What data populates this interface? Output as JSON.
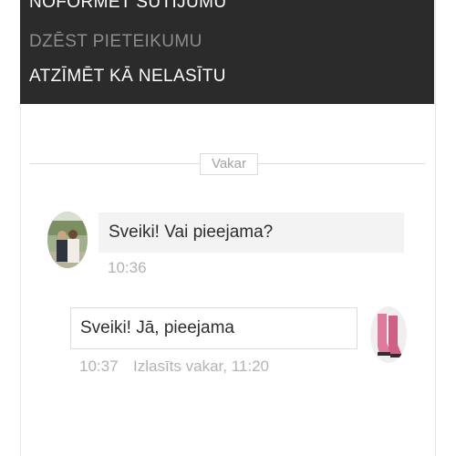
{
  "menu": {
    "items": [
      {
        "label": "NOFORMĒT SŪTĪJUMU"
      },
      {
        "label": "DZĒST PIETEIKUMU"
      },
      {
        "label": "ATZĪMĒT KĀ NELASĪTU"
      }
    ]
  },
  "chat": {
    "date_divider": "Vakar",
    "messages": [
      {
        "text": "Sveiki! Vai pieejama?",
        "time": "10:36",
        "direction": "incoming",
        "avatar": "person-photo"
      },
      {
        "text": "Sveiki! Jā, pieejama",
        "time": "10:37",
        "status": "Izlasīts vakar, 11:20",
        "direction": "outgoing",
        "avatar": "pink-boots-photo"
      }
    ]
  },
  "colors": {
    "menu_background": "#2b2b2b",
    "menu_text": "#ffffff",
    "menu_text_disabled": "#8c8c8c",
    "incoming_bubble": "#f3f3f3",
    "meta_text": "#b3b3b3"
  }
}
